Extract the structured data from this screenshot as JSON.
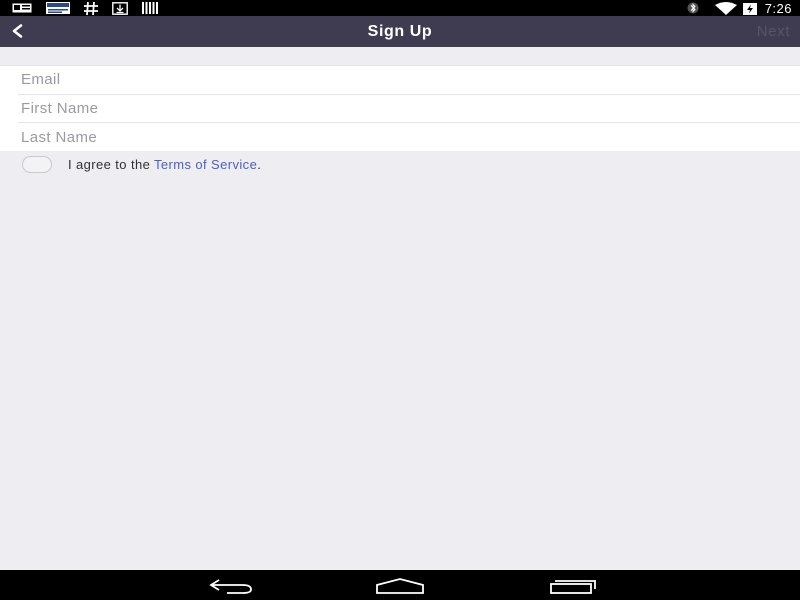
{
  "status_bar": {
    "time": "7:26",
    "left_icons": [
      "notification-card-icon",
      "news-app-icon",
      "hashtag-icon",
      "download-icon",
      "barcode-icon"
    ],
    "right_icons": [
      "bluetooth-icon",
      "wifi-icon",
      "battery-charging-icon"
    ]
  },
  "nav": {
    "title": "Sign Up",
    "next_label": "Next",
    "back_icon": "back-chevron-icon"
  },
  "form": {
    "email_placeholder": "Email",
    "first_name_placeholder": "First Name",
    "last_name_placeholder": "Last Name"
  },
  "agreement": {
    "prefix": "I agree to the ",
    "link_text": "Terms of Service",
    "suffix": "."
  },
  "system_nav": {
    "icons": [
      "back-icon",
      "home-icon",
      "recents-icon"
    ]
  },
  "colors": {
    "nav_background": "#3f3c52",
    "page_background": "#ededf2",
    "link": "#4c5fc9",
    "next_disabled": "#57546a"
  }
}
